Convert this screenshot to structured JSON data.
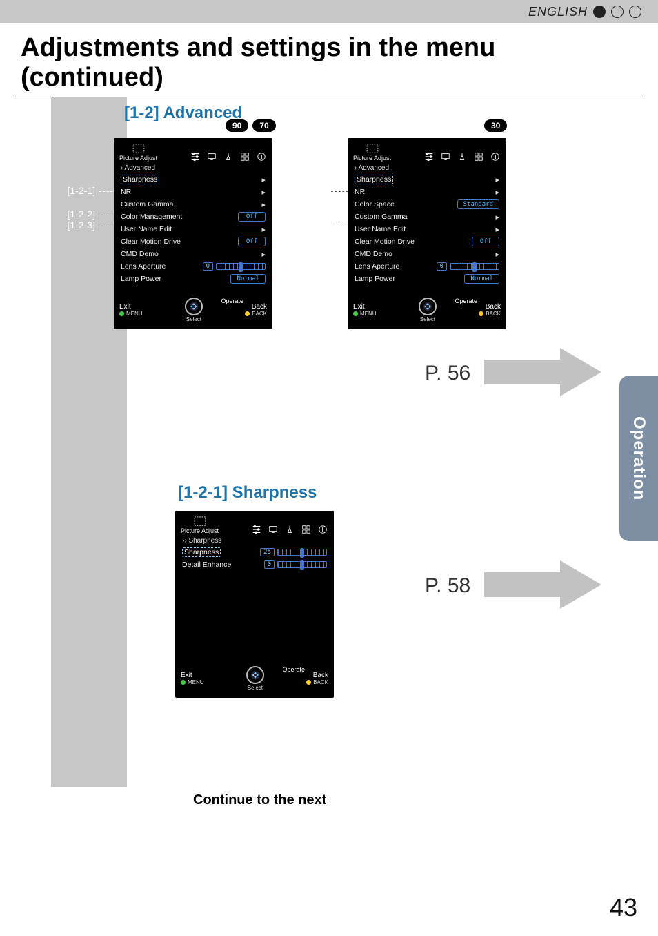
{
  "header": {
    "language": "ENGLISH"
  },
  "title": "Adjustments and settings in the menu (continued)",
  "badges_left": [
    "90",
    "70"
  ],
  "badges_right": [
    "30"
  ],
  "side_tab": "Operation",
  "page_number": "43",
  "continue_text": "Continue to the next",
  "sections": {
    "s12": "[1-2] Advanced",
    "s121": "[1-2-1] Sharpness"
  },
  "callouts_left": {
    "a": "[1-2-1]",
    "b": "[1-2-2]",
    "c": "[1-2-3]"
  },
  "callouts_right": {
    "a": "[1-2-1]",
    "b": "[1-2-2]"
  },
  "page_refs": {
    "p1": "P. 56",
    "p2": "P. 58"
  },
  "osd_common": {
    "active_tab": "Picture Adjust",
    "exit": "Exit",
    "menu_label": "MENU",
    "operate": "Operate",
    "select": "Select",
    "back": "Back",
    "back_btn": "BACK",
    "arrow": "▸"
  },
  "osd1": {
    "crumbs": "› Advanced",
    "rows": [
      {
        "label": "Sharpness",
        "type": "arrow",
        "selected": true
      },
      {
        "label": "NR",
        "type": "arrow"
      },
      {
        "label": "Custom Gamma",
        "type": "arrow"
      },
      {
        "label": "Color Management",
        "type": "pill",
        "value": "Off"
      },
      {
        "label": "User Name Edit",
        "type": "arrow"
      },
      {
        "label": "Clear Motion Drive",
        "type": "pill",
        "value": "Off"
      },
      {
        "label": "CMD Demo",
        "type": "arrow"
      },
      {
        "label": "Lens Aperture",
        "type": "numslider",
        "value": "0"
      },
      {
        "label": "Lamp Power",
        "type": "pill",
        "value": "Normal"
      }
    ]
  },
  "osd2": {
    "crumbs": "› Advanced",
    "rows": [
      {
        "label": "Sharpness",
        "type": "arrow",
        "selected": true
      },
      {
        "label": "NR",
        "type": "arrow"
      },
      {
        "label": "Color Space",
        "type": "pill",
        "value": "Standard"
      },
      {
        "label": "Custom Gamma",
        "type": "arrow"
      },
      {
        "label": "User Name Edit",
        "type": "arrow"
      },
      {
        "label": "Clear Motion Drive",
        "type": "pill",
        "value": "Off"
      },
      {
        "label": "CMD Demo",
        "type": "arrow"
      },
      {
        "label": "Lens Aperture",
        "type": "numslider",
        "value": "0"
      },
      {
        "label": "Lamp Power",
        "type": "pill",
        "value": "Normal"
      }
    ]
  },
  "osd3": {
    "crumbs": "›› Sharpness",
    "rows": [
      {
        "label": "Sharpness",
        "type": "numslider",
        "value": "25",
        "selected": true
      },
      {
        "label": "Detail Enhance",
        "type": "numslider",
        "value": "0"
      }
    ]
  }
}
